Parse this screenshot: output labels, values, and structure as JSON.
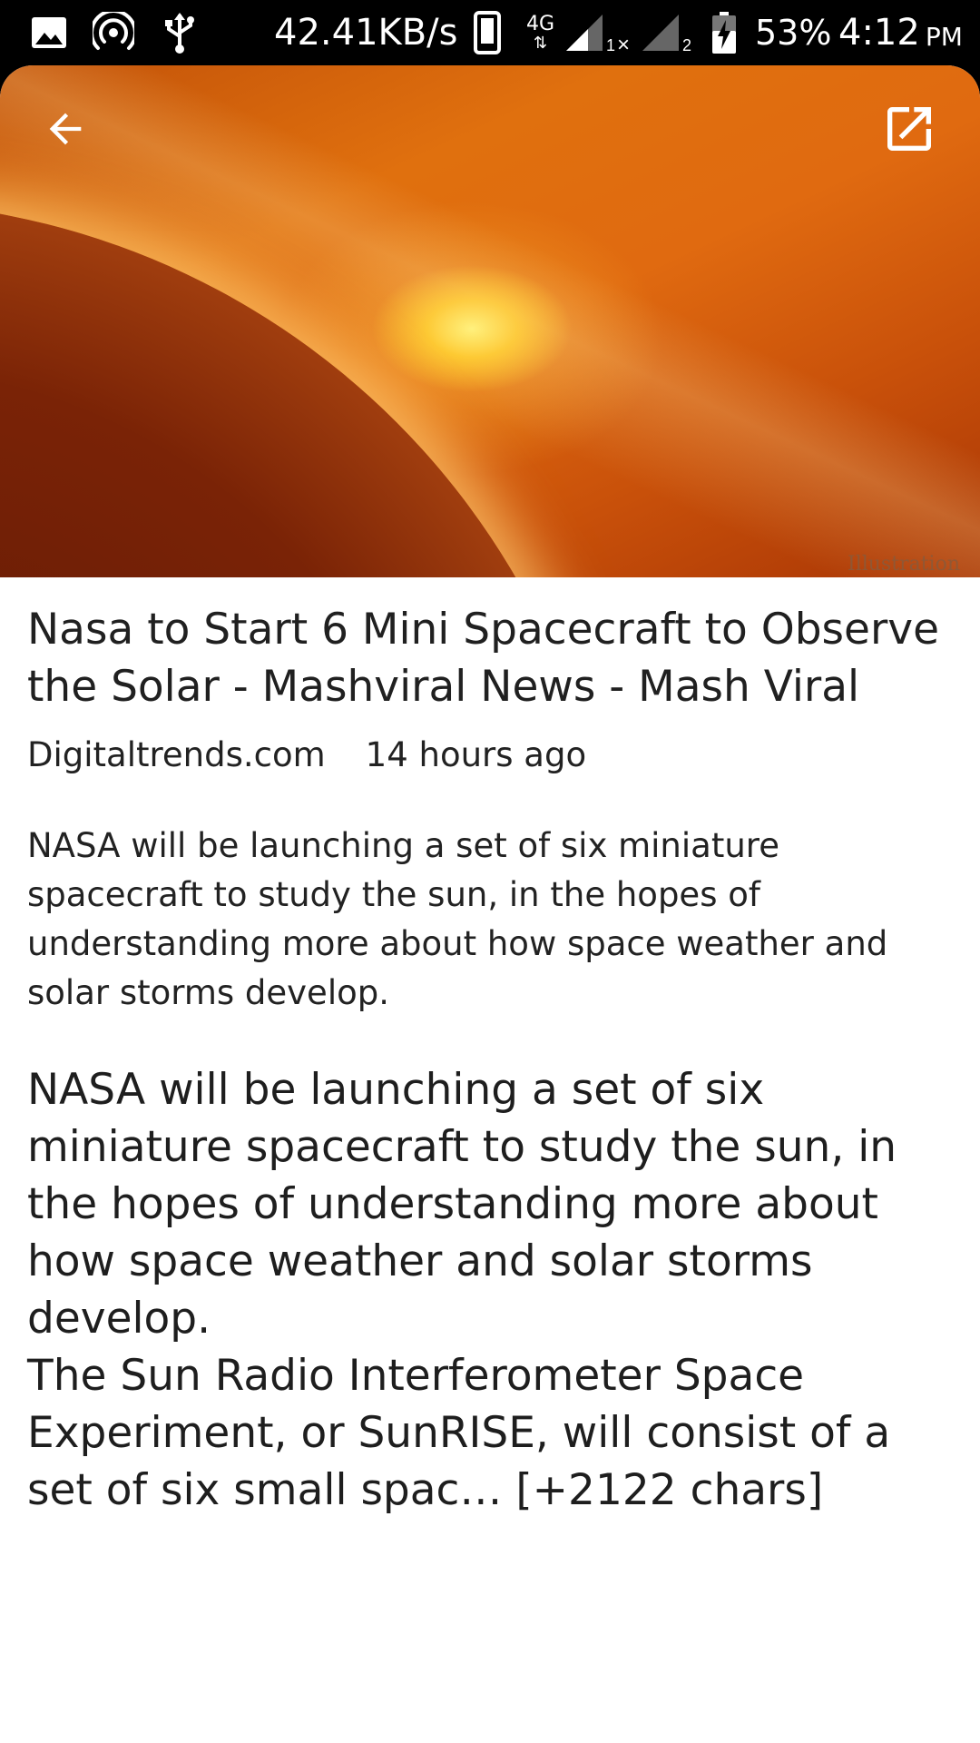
{
  "status_bar": {
    "speed": "42.41KB/s",
    "network": "4G",
    "sim1_label": "1",
    "sim2_label": "2",
    "battery": "53%",
    "time": "4:12",
    "ampm": "PM"
  },
  "article": {
    "caption": "Illustration",
    "title": "Nasa to Start 6 Mini Spacecraft to Observe the Solar - Mashviral News - Mash Viral",
    "source": "Digitaltrends.com",
    "time_ago": "14 hours ago",
    "summary": "NASA will be launching a set of six miniature spacecraft to study the sun, in the hopes of understanding more about how space weather and solar storms develop.",
    "body_p1": "NASA will be launching a set of six miniature spacecraft to study the sun, in the hopes of understanding more about how space weather and solar storms develop.",
    "body_p2": "The Sun Radio Interferometer Space Experiment, or SunRISE, will consist of a set of six small spac… [+2122 chars]"
  },
  "icons": {
    "back": "arrow-back-icon",
    "open_external": "open-in-new-icon"
  },
  "colors": {
    "status_bar_bg": "#000000",
    "card_bg": "#ffffff",
    "text": "#222222"
  }
}
